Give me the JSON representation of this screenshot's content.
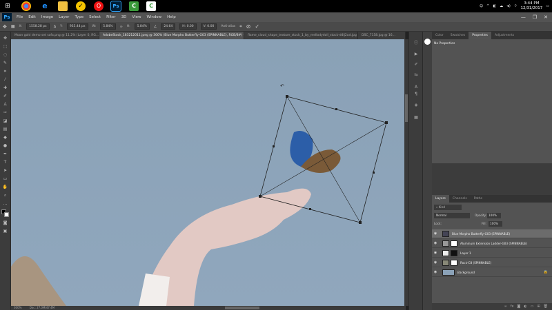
{
  "taskbar": {
    "clock_time": "3:44 PM",
    "clock_date": "12/31/2017",
    "icons": [
      "start-icon",
      "chrome-icon",
      "edge-icon",
      "file-explorer-icon",
      "norton-icon",
      "opera-icon",
      "photoshop-icon",
      "camtasia-icon",
      "camtasia-recorder-icon"
    ]
  },
  "menubar": {
    "logo": "Ps",
    "items": [
      "File",
      "Edit",
      "Image",
      "Layer",
      "Type",
      "Select",
      "Filter",
      "3D",
      "View",
      "Window",
      "Help"
    ]
  },
  "options": {
    "x_label": "X:",
    "x_value": "1558.28 px",
    "y_label": "Y:",
    "y_value": "935.44 px",
    "w_label": "W:",
    "w_value": "5.84%",
    "h_label": "H:",
    "h_value": "5.84%",
    "angle_value": "24.64",
    "interp": "H: 0.00",
    "interp2": "V: 0.00",
    "aa_label": "Anti-alias"
  },
  "tabs": [
    "Moon gold demo set sofa.png @ 11.2% (Layer 0, RG...",
    "AdobeStock_183212011.jpeg @ 300% (Blue Morpho Butterfly-G03 (SPINNABLE), RGB/8#) *",
    "flame_cloud_shape_texture_stock_1_by_mellodydoll_stock-d4lj2ud.jpg @ 18...",
    "DSC_7158.jpg @ 16..."
  ],
  "status": {
    "zoom": "300%",
    "doc": "Doc: 27.0M/47.4M"
  },
  "right_panel": {
    "top_tabs": [
      "Color",
      "Swatches",
      "Properties",
      "Adjustments"
    ],
    "props_text": "No Properties",
    "layer_tabs": [
      "Layers",
      "Channels",
      "Paths"
    ],
    "kind": "Kind",
    "blend_mode": "Normal",
    "opacity_label": "Opacity:",
    "opacity_value": "100%",
    "lock_label": "Lock:",
    "fill_label": "Fill:",
    "fill_value": "100%",
    "layers": [
      {
        "name": "Blue Morpho Butterfly-G03 (SPINNABLE)"
      },
      {
        "name": "Aluminum Extension Ladder-G03 (SPINNABLE)"
      },
      {
        "name": "Layer 1"
      },
      {
        "name": "Rock-C8 (SPINNABLE)"
      },
      {
        "name": "Background"
      }
    ]
  }
}
